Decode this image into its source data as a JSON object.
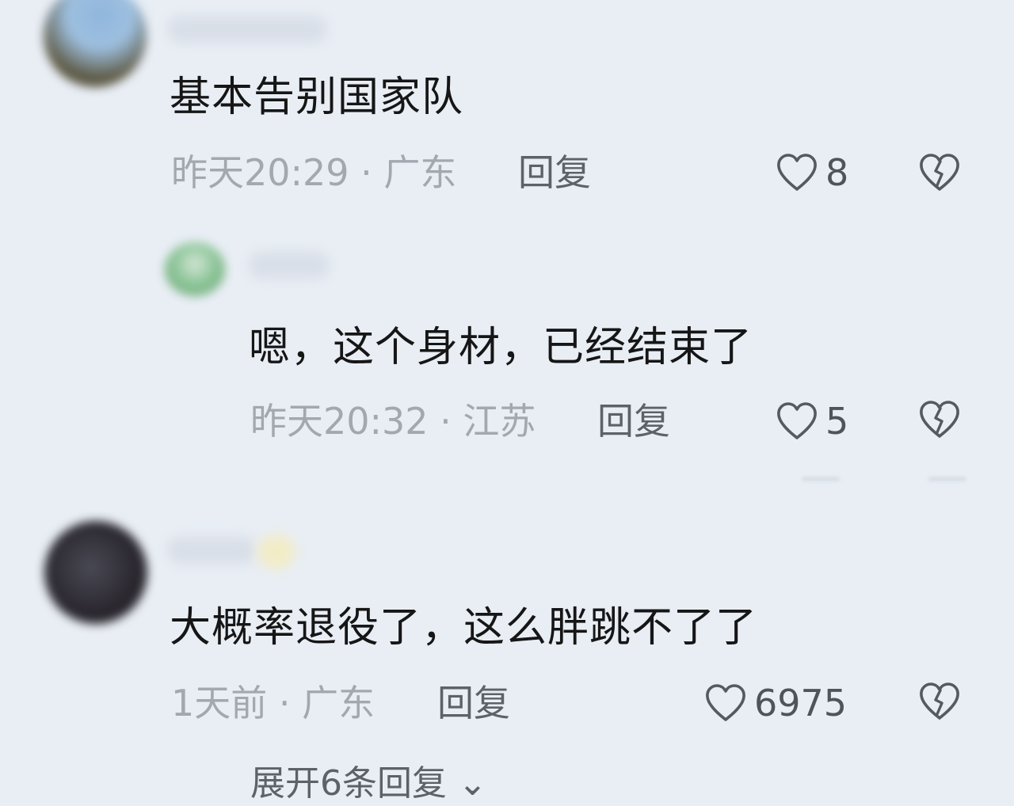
{
  "comments": [
    {
      "text": "基本告别国家队",
      "meta": "昨天20:29 · 广东",
      "reply_label": "回复",
      "likes": "8"
    },
    {
      "text": "嗯，这个身材，已经结束了",
      "meta": "昨天20:32 · 江苏",
      "reply_label": "回复",
      "likes": "5"
    },
    {
      "text": "大概率退役了，这么胖跳不了了",
      "meta": "1天前 · 广东",
      "reply_label": "回复",
      "likes": "6975"
    }
  ],
  "expand_replies": "展开6条回复 ⌄",
  "icons": {
    "like": "heart-outline-icon",
    "dislike": "broken-heart-icon"
  },
  "colors": {
    "background": "#e9eef5",
    "text_primary": "#161616",
    "text_meta": "#a3a8b0",
    "text_action": "#5d6269"
  }
}
